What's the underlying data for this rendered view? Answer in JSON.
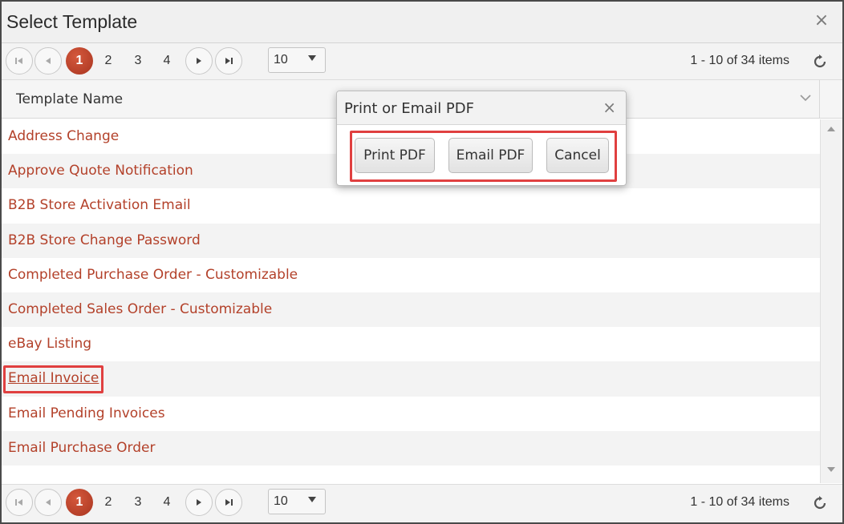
{
  "dialog": {
    "title": "Select Template",
    "close_glyph": "×"
  },
  "pager": {
    "pages": [
      "1",
      "2",
      "3",
      "4"
    ],
    "active_page": "1",
    "page_size": "10",
    "info": "1 - 10 of 34 items"
  },
  "grid": {
    "column_header": "Template Name",
    "rows": [
      "Address Change",
      "Approve Quote Notification",
      "B2B Store Activation Email",
      "B2B Store Change Password",
      "Completed Purchase Order - Customizable",
      "Completed Sales Order - Customizable",
      "eBay Listing",
      "Email Invoice",
      "Email Pending Invoices",
      "Email Purchase Order"
    ],
    "highlighted_row": "Email Invoice"
  },
  "popup": {
    "title": "Print or Email PDF",
    "close_glyph": "×",
    "print_label": "Print PDF",
    "email_label": "Email PDF",
    "cancel_label": "Cancel"
  },
  "colors": {
    "link": "#b3412a",
    "active_page": "#b8422a",
    "highlight": "#e04040"
  },
  "icons": [
    "first-page-icon",
    "prev-page-icon",
    "next-page-icon",
    "last-page-icon",
    "dropdown-caret-icon",
    "refresh-icon",
    "column-menu-icon",
    "scroll-up-icon",
    "scroll-down-icon",
    "close-icon"
  ]
}
